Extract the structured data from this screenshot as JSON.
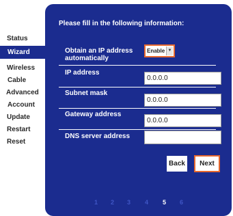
{
  "sidebar": {
    "items": [
      {
        "label": "Status",
        "active": false
      },
      {
        "label": "Wizard",
        "active": true
      },
      {
        "label": "Wireless",
        "active": false
      },
      {
        "label": "Cable",
        "active": false
      },
      {
        "label": "Advanced",
        "active": false
      },
      {
        "label": "Account",
        "active": false
      },
      {
        "label": "Update",
        "active": false
      },
      {
        "label": "Restart",
        "active": false
      },
      {
        "label": "Reset",
        "active": false
      }
    ]
  },
  "form": {
    "heading": "Please fill in the following information:",
    "obtain_ip": {
      "label_line1": "Obtain an IP address",
      "label_line2": "automatically",
      "selected": "Enable"
    },
    "ip_address": {
      "label": "IP address",
      "value": "0.0.0.0"
    },
    "subnet_mask": {
      "label": "Subnet mask",
      "value": "0.0.0.0"
    },
    "gateway_address": {
      "label": "Gateway address",
      "value": "0.0.0.0"
    },
    "dns_server": {
      "label": "DNS server address",
      "value": ""
    },
    "back_label": "Back",
    "next_label": "Next"
  },
  "steps": {
    "items": [
      "1",
      "2",
      "3",
      "4",
      "5",
      "6"
    ],
    "current": "5"
  },
  "colors": {
    "panel": "#1b2c8f",
    "accent": "#e8692e",
    "step_inactive": "#3f56c6"
  }
}
